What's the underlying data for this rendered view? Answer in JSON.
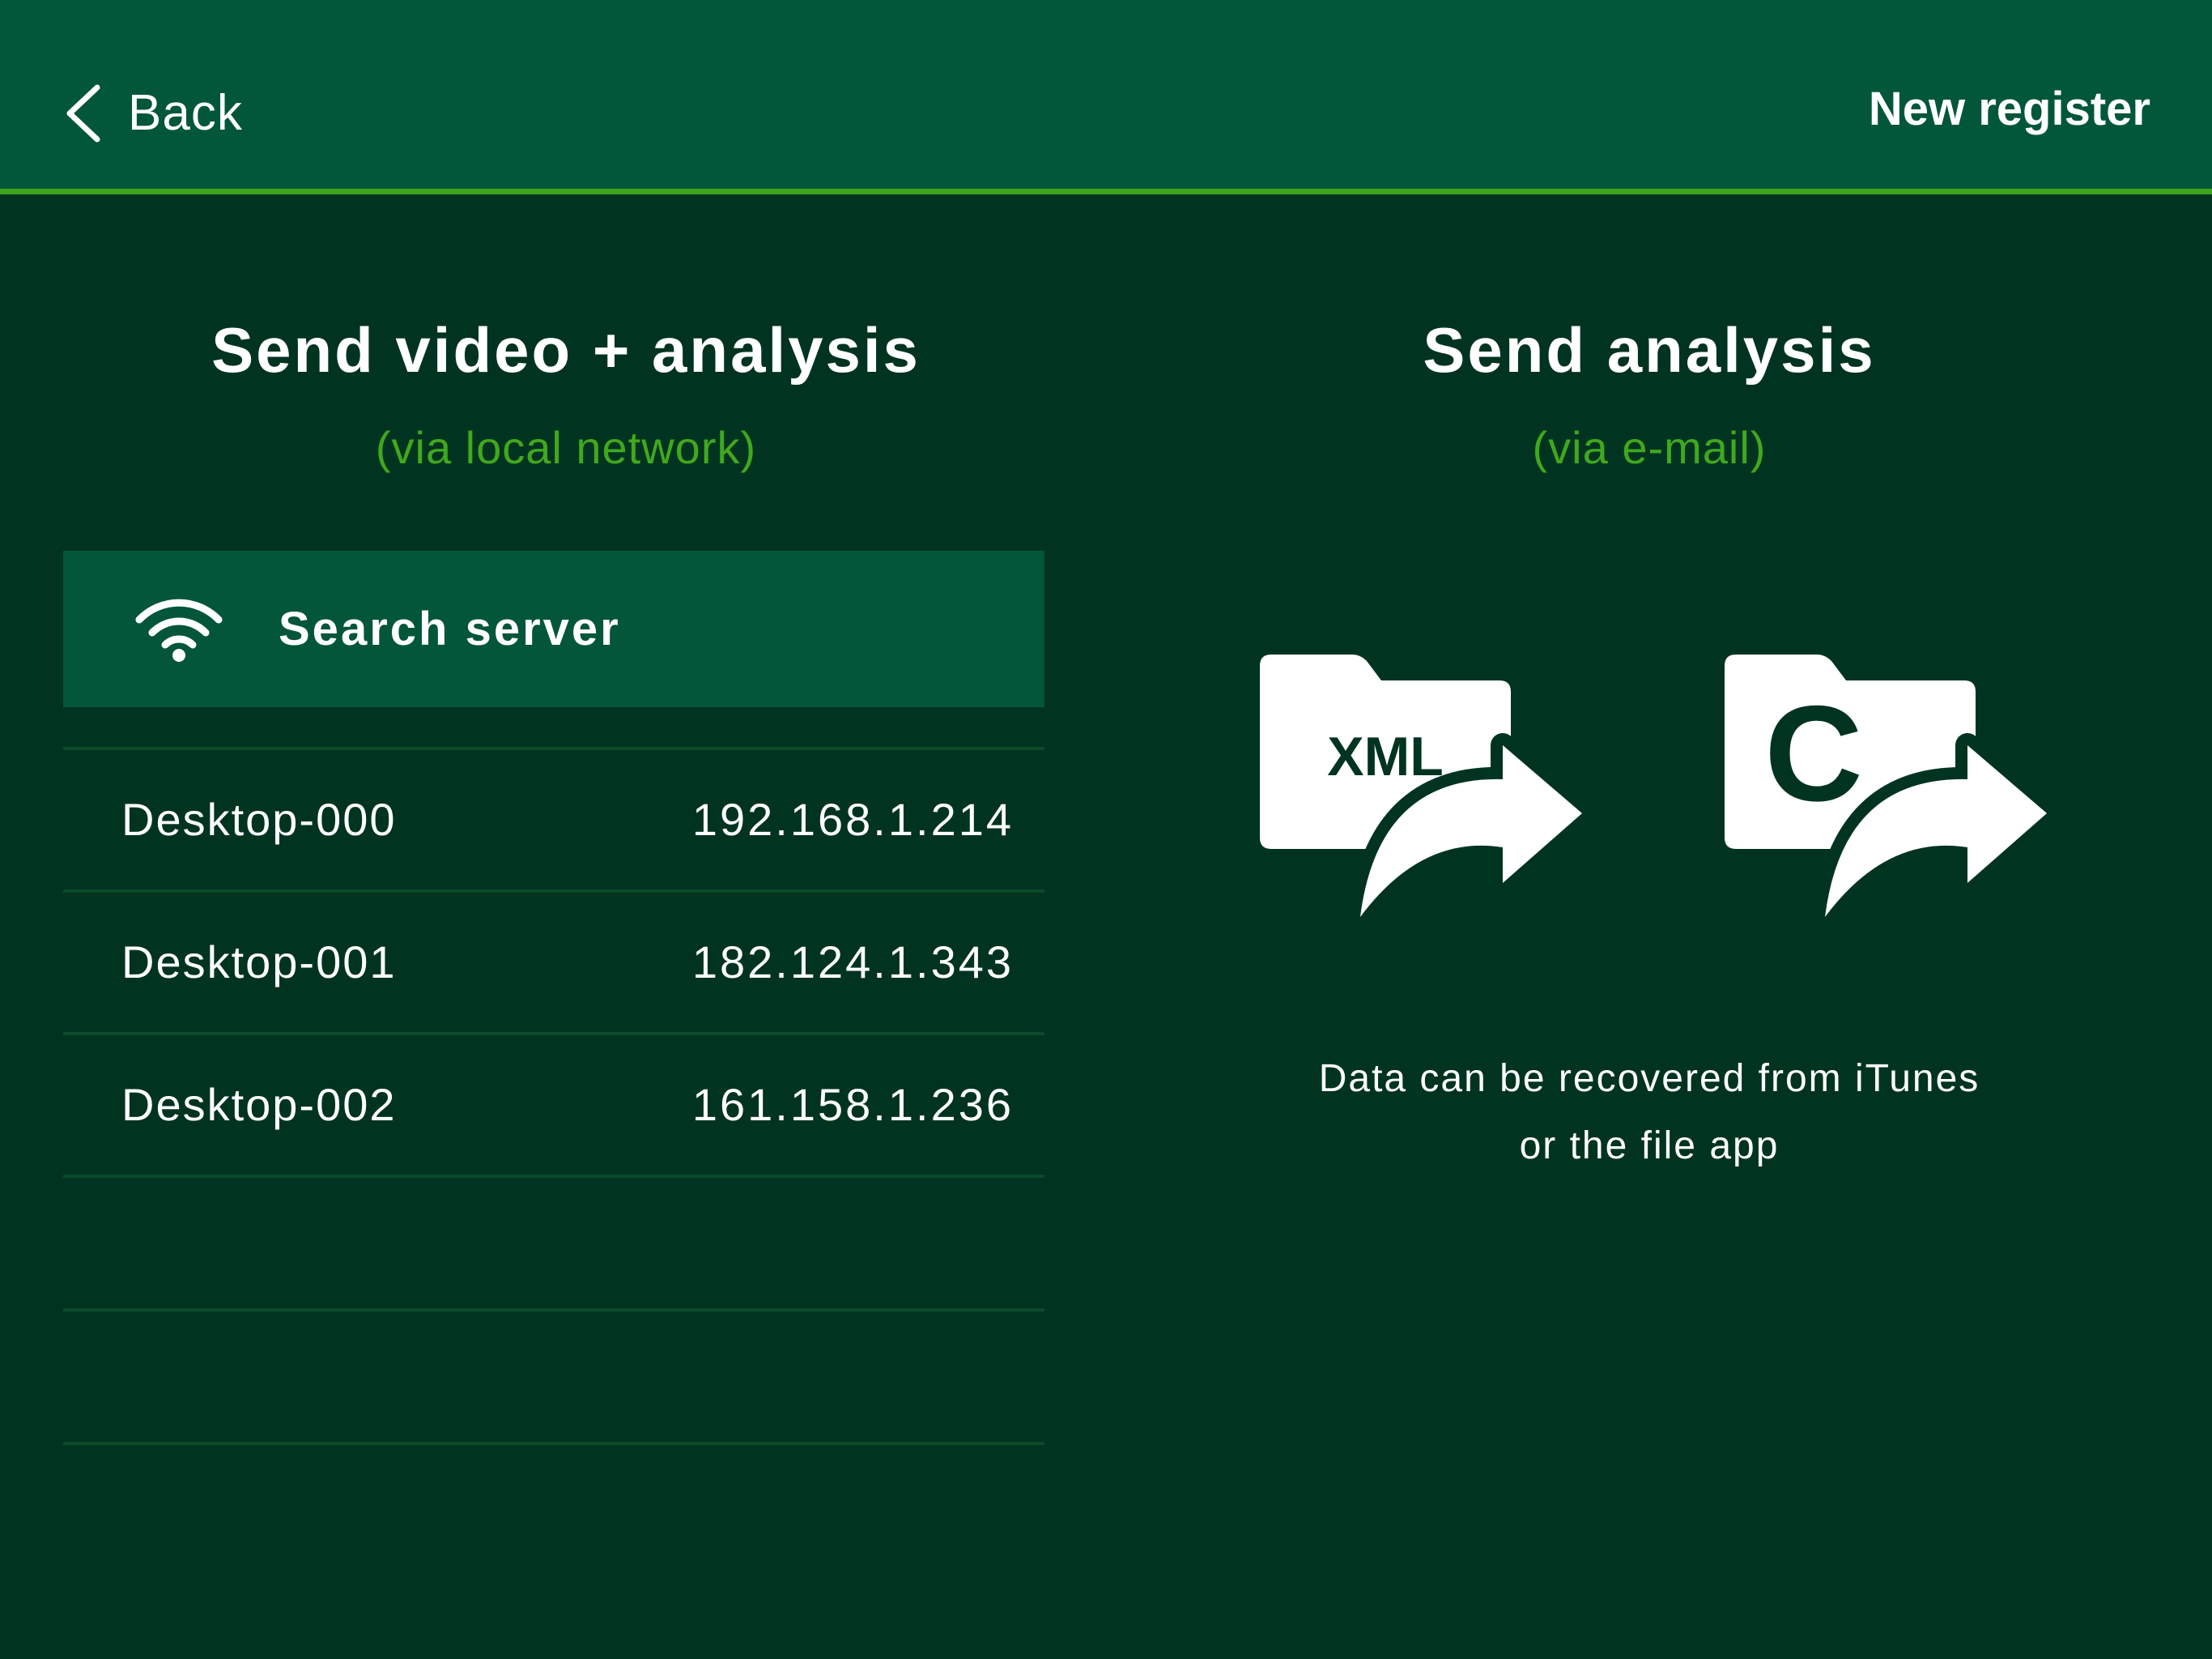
{
  "header": {
    "back_label": "Back",
    "action_label": "New register"
  },
  "left_panel": {
    "title": "Send video + analysis",
    "subtitle": "(via local network)",
    "search_label": "Search server",
    "servers": [
      {
        "name": "Desktop-000",
        "ip": "192.168.1.214"
      },
      {
        "name": "Desktop-001",
        "ip": "182.124.1.343"
      },
      {
        "name": "Desktop-002",
        "ip": "161.158.1.236"
      }
    ]
  },
  "right_panel": {
    "title": "Send analysis",
    "subtitle": "(via e-mail)",
    "exports": [
      {
        "label": "XML",
        "icon": "xml-folder-share-icon"
      },
      {
        "label": "C",
        "icon": "c-folder-share-icon"
      }
    ],
    "info_line1": "Data can be recovered from iTunes",
    "info_line2": "or the file app"
  },
  "colors": {
    "background": "#003420",
    "header": "#02573a",
    "accent": "#3fa41b",
    "button": "#03563a",
    "subtitle": "#41a81e"
  }
}
